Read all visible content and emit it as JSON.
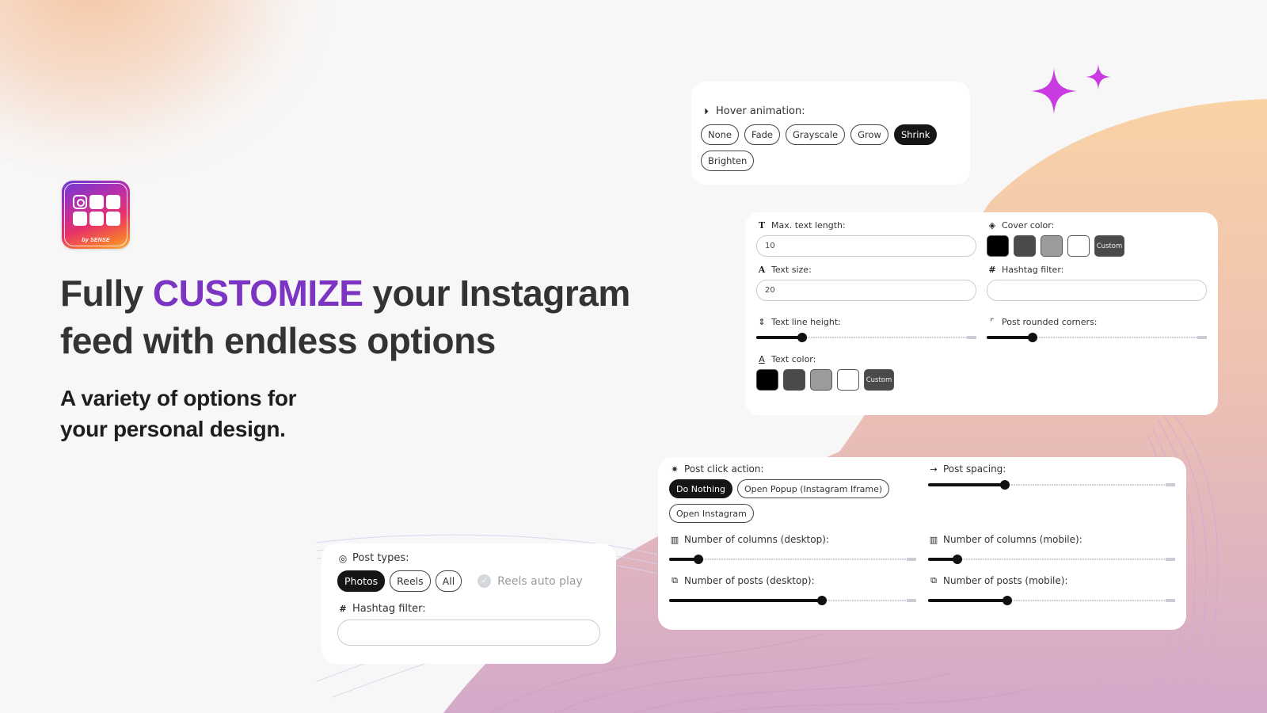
{
  "brand": {
    "logo_tagline": "by SENSE",
    "accent_color": "#7b35c2",
    "sparkle_color": "#c93ae0"
  },
  "hero": {
    "headline_before": "Fully",
    "headline_accent": "CUSTOMIZE",
    "headline_after": "your Instagram",
    "headline_line2": "feed with endless options",
    "sub_line1": "A variety of options for",
    "sub_line2": "your personal design."
  },
  "hover_card": {
    "label": "Hover animation:",
    "icon": "play-circle-icon",
    "options": [
      "None",
      "Fade",
      "Grayscale",
      "Grow",
      "Shrink",
      "Brighten"
    ],
    "selected": "Shrink"
  },
  "text_card": {
    "max_text_length": {
      "label": "Max. text length:",
      "icon": "text-t-icon",
      "value": "10"
    },
    "cover_color": {
      "label": "Cover color:",
      "icon": "paint-bucket-icon",
      "swatches": [
        "#000000",
        "#4a4a4a",
        "#9b9b9b",
        "#ffffff"
      ],
      "custom_label": "Custom"
    },
    "text_size": {
      "label": "Text size:",
      "icon": "text-a-icon",
      "value": "20"
    },
    "hashtag_filter": {
      "label": "Hashtag filter:",
      "icon": "hash-icon",
      "value": ""
    },
    "text_line_height": {
      "label": "Text line height:",
      "icon": "line-height-icon",
      "value_fraction": 0.21
    },
    "post_rounded_corners": {
      "label": "Post rounded corners:",
      "icon": "corner-icon",
      "value_fraction": 0.21
    },
    "text_color": {
      "label": "Text color:",
      "icon": "text-color-icon",
      "swatches": [
        "#000000",
        "#4a4a4a",
        "#9b9b9b",
        "#ffffff"
      ],
      "custom_label": "Custom"
    }
  },
  "click_card": {
    "post_click_action": {
      "label": "Post click action:",
      "icon": "cursor-click-icon",
      "options": [
        "Do Nothing",
        "Open Popup (Instagram Iframe)",
        "Open Instagram"
      ],
      "selected": "Do Nothing"
    },
    "post_spacing": {
      "label": "Post spacing:",
      "icon": "arrow-right-icon",
      "value_fraction": 0.31
    },
    "columns_desktop": {
      "label": "Number of columns (desktop):",
      "icon": "columns-icon",
      "value_fraction": 0.12
    },
    "columns_mobile": {
      "label": "Number of columns (mobile):",
      "icon": "columns-icon",
      "value_fraction": 0.12
    },
    "posts_desktop": {
      "label": "Number of posts (desktop):",
      "icon": "posts-stack-icon",
      "value_fraction": 0.62
    },
    "posts_mobile": {
      "label": "Number of posts (mobile):",
      "icon": "posts-stack-icon",
      "value_fraction": 0.32
    }
  },
  "types_card": {
    "post_types": {
      "label": "Post types:",
      "icon": "instagram-icon",
      "options": [
        "Photos",
        "Reels",
        "All"
      ],
      "selected": "Photos"
    },
    "reels_auto_play": {
      "label": "Reels auto play",
      "checked": true,
      "disabled": true
    },
    "hashtag_filter": {
      "label": "Hashtag filter:",
      "icon": "hash-icon",
      "value": ""
    }
  }
}
